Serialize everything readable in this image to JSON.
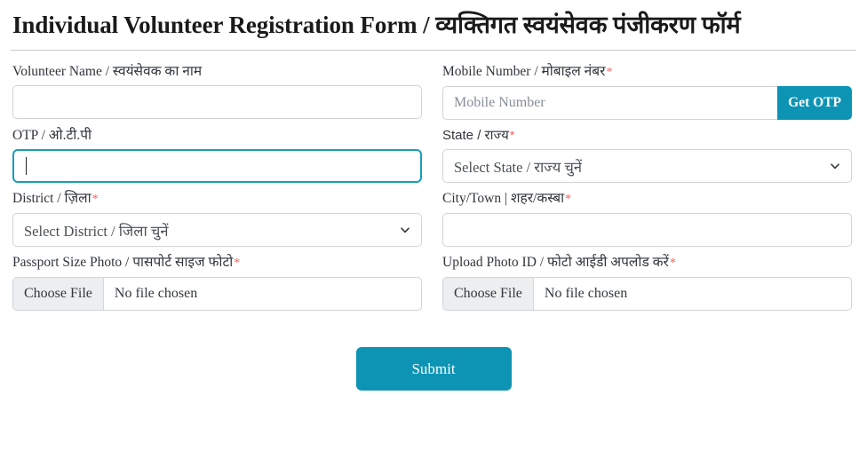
{
  "header": {
    "title": "Individual Volunteer Registration Form / व्यक्तिगत स्वयंसेवक पंजीकरण फॉर्म"
  },
  "colors": {
    "accent": "#0d94b4",
    "focus_border": "#1a9cbd",
    "required_asterisk": "#f4615f",
    "input_border": "#ced4da",
    "file_button_bg": "#eceef0"
  },
  "fields": {
    "volunteer_name": {
      "label": "Volunteer Name / स्वयंसेवक का नाम",
      "value": "",
      "placeholder": ""
    },
    "mobile_number": {
      "label": "Mobile Number / मोबाइल नंबर",
      "required": "*",
      "value": "",
      "placeholder": "Mobile Number",
      "button_label": "Get OTP"
    },
    "otp": {
      "label": "OTP / ओ.टी.पी",
      "value": "",
      "placeholder": ""
    },
    "state": {
      "label": "State / राज्य",
      "required": "*",
      "selected": "Select State / राज्य चुनें"
    },
    "district": {
      "label": "District / ज़िला",
      "required": "*",
      "selected": "Select District / जिला चुनें"
    },
    "city_town": {
      "label": "City/Town | शहर/कस्बा",
      "required": "*",
      "value": "",
      "placeholder": ""
    },
    "passport_photo": {
      "label": "Passport Size Photo / पासपोर्ट साइज फोटो",
      "required": "*",
      "button_label": "Choose File",
      "status": "No file chosen"
    },
    "photo_id": {
      "label": "Upload Photo ID / फोटो आईडी अपलोड करें",
      "required": "*",
      "button_label": "Choose File",
      "status": "No file chosen"
    }
  },
  "actions": {
    "submit_label": "Submit"
  }
}
